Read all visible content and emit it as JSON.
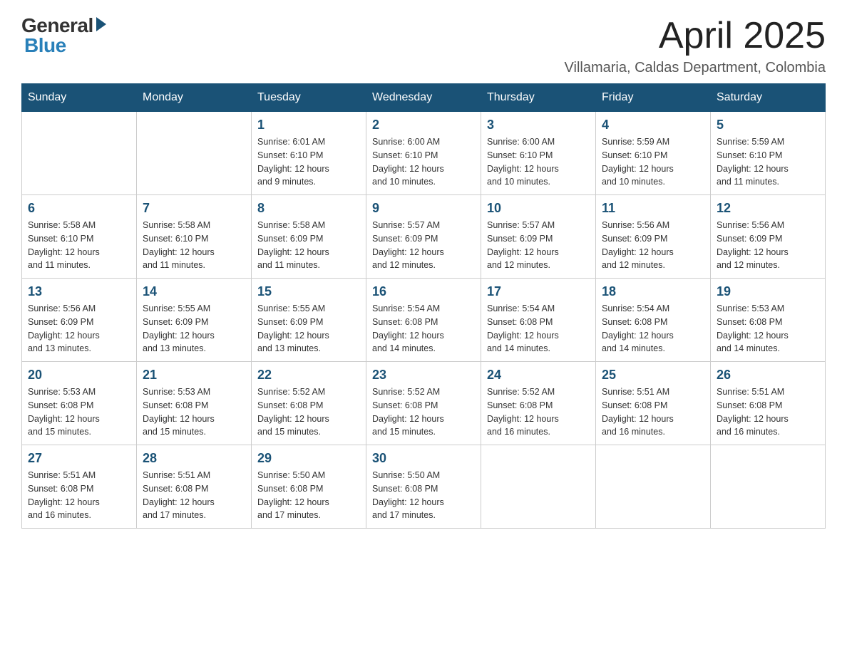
{
  "header": {
    "logo_general": "General",
    "logo_blue": "Blue",
    "month_year": "April 2025",
    "location": "Villamaria, Caldas Department, Colombia"
  },
  "days_of_week": [
    "Sunday",
    "Monday",
    "Tuesday",
    "Wednesday",
    "Thursday",
    "Friday",
    "Saturday"
  ],
  "weeks": [
    [
      {
        "day": "",
        "info": ""
      },
      {
        "day": "",
        "info": ""
      },
      {
        "day": "1",
        "info": "Sunrise: 6:01 AM\nSunset: 6:10 PM\nDaylight: 12 hours\nand 9 minutes."
      },
      {
        "day": "2",
        "info": "Sunrise: 6:00 AM\nSunset: 6:10 PM\nDaylight: 12 hours\nand 10 minutes."
      },
      {
        "day": "3",
        "info": "Sunrise: 6:00 AM\nSunset: 6:10 PM\nDaylight: 12 hours\nand 10 minutes."
      },
      {
        "day": "4",
        "info": "Sunrise: 5:59 AM\nSunset: 6:10 PM\nDaylight: 12 hours\nand 10 minutes."
      },
      {
        "day": "5",
        "info": "Sunrise: 5:59 AM\nSunset: 6:10 PM\nDaylight: 12 hours\nand 11 minutes."
      }
    ],
    [
      {
        "day": "6",
        "info": "Sunrise: 5:58 AM\nSunset: 6:10 PM\nDaylight: 12 hours\nand 11 minutes."
      },
      {
        "day": "7",
        "info": "Sunrise: 5:58 AM\nSunset: 6:10 PM\nDaylight: 12 hours\nand 11 minutes."
      },
      {
        "day": "8",
        "info": "Sunrise: 5:58 AM\nSunset: 6:09 PM\nDaylight: 12 hours\nand 11 minutes."
      },
      {
        "day": "9",
        "info": "Sunrise: 5:57 AM\nSunset: 6:09 PM\nDaylight: 12 hours\nand 12 minutes."
      },
      {
        "day": "10",
        "info": "Sunrise: 5:57 AM\nSunset: 6:09 PM\nDaylight: 12 hours\nand 12 minutes."
      },
      {
        "day": "11",
        "info": "Sunrise: 5:56 AM\nSunset: 6:09 PM\nDaylight: 12 hours\nand 12 minutes."
      },
      {
        "day": "12",
        "info": "Sunrise: 5:56 AM\nSunset: 6:09 PM\nDaylight: 12 hours\nand 12 minutes."
      }
    ],
    [
      {
        "day": "13",
        "info": "Sunrise: 5:56 AM\nSunset: 6:09 PM\nDaylight: 12 hours\nand 13 minutes."
      },
      {
        "day": "14",
        "info": "Sunrise: 5:55 AM\nSunset: 6:09 PM\nDaylight: 12 hours\nand 13 minutes."
      },
      {
        "day": "15",
        "info": "Sunrise: 5:55 AM\nSunset: 6:09 PM\nDaylight: 12 hours\nand 13 minutes."
      },
      {
        "day": "16",
        "info": "Sunrise: 5:54 AM\nSunset: 6:08 PM\nDaylight: 12 hours\nand 14 minutes."
      },
      {
        "day": "17",
        "info": "Sunrise: 5:54 AM\nSunset: 6:08 PM\nDaylight: 12 hours\nand 14 minutes."
      },
      {
        "day": "18",
        "info": "Sunrise: 5:54 AM\nSunset: 6:08 PM\nDaylight: 12 hours\nand 14 minutes."
      },
      {
        "day": "19",
        "info": "Sunrise: 5:53 AM\nSunset: 6:08 PM\nDaylight: 12 hours\nand 14 minutes."
      }
    ],
    [
      {
        "day": "20",
        "info": "Sunrise: 5:53 AM\nSunset: 6:08 PM\nDaylight: 12 hours\nand 15 minutes."
      },
      {
        "day": "21",
        "info": "Sunrise: 5:53 AM\nSunset: 6:08 PM\nDaylight: 12 hours\nand 15 minutes."
      },
      {
        "day": "22",
        "info": "Sunrise: 5:52 AM\nSunset: 6:08 PM\nDaylight: 12 hours\nand 15 minutes."
      },
      {
        "day": "23",
        "info": "Sunrise: 5:52 AM\nSunset: 6:08 PM\nDaylight: 12 hours\nand 15 minutes."
      },
      {
        "day": "24",
        "info": "Sunrise: 5:52 AM\nSunset: 6:08 PM\nDaylight: 12 hours\nand 16 minutes."
      },
      {
        "day": "25",
        "info": "Sunrise: 5:51 AM\nSunset: 6:08 PM\nDaylight: 12 hours\nand 16 minutes."
      },
      {
        "day": "26",
        "info": "Sunrise: 5:51 AM\nSunset: 6:08 PM\nDaylight: 12 hours\nand 16 minutes."
      }
    ],
    [
      {
        "day": "27",
        "info": "Sunrise: 5:51 AM\nSunset: 6:08 PM\nDaylight: 12 hours\nand 16 minutes."
      },
      {
        "day": "28",
        "info": "Sunrise: 5:51 AM\nSunset: 6:08 PM\nDaylight: 12 hours\nand 17 minutes."
      },
      {
        "day": "29",
        "info": "Sunrise: 5:50 AM\nSunset: 6:08 PM\nDaylight: 12 hours\nand 17 minutes."
      },
      {
        "day": "30",
        "info": "Sunrise: 5:50 AM\nSunset: 6:08 PM\nDaylight: 12 hours\nand 17 minutes."
      },
      {
        "day": "",
        "info": ""
      },
      {
        "day": "",
        "info": ""
      },
      {
        "day": "",
        "info": ""
      }
    ]
  ]
}
